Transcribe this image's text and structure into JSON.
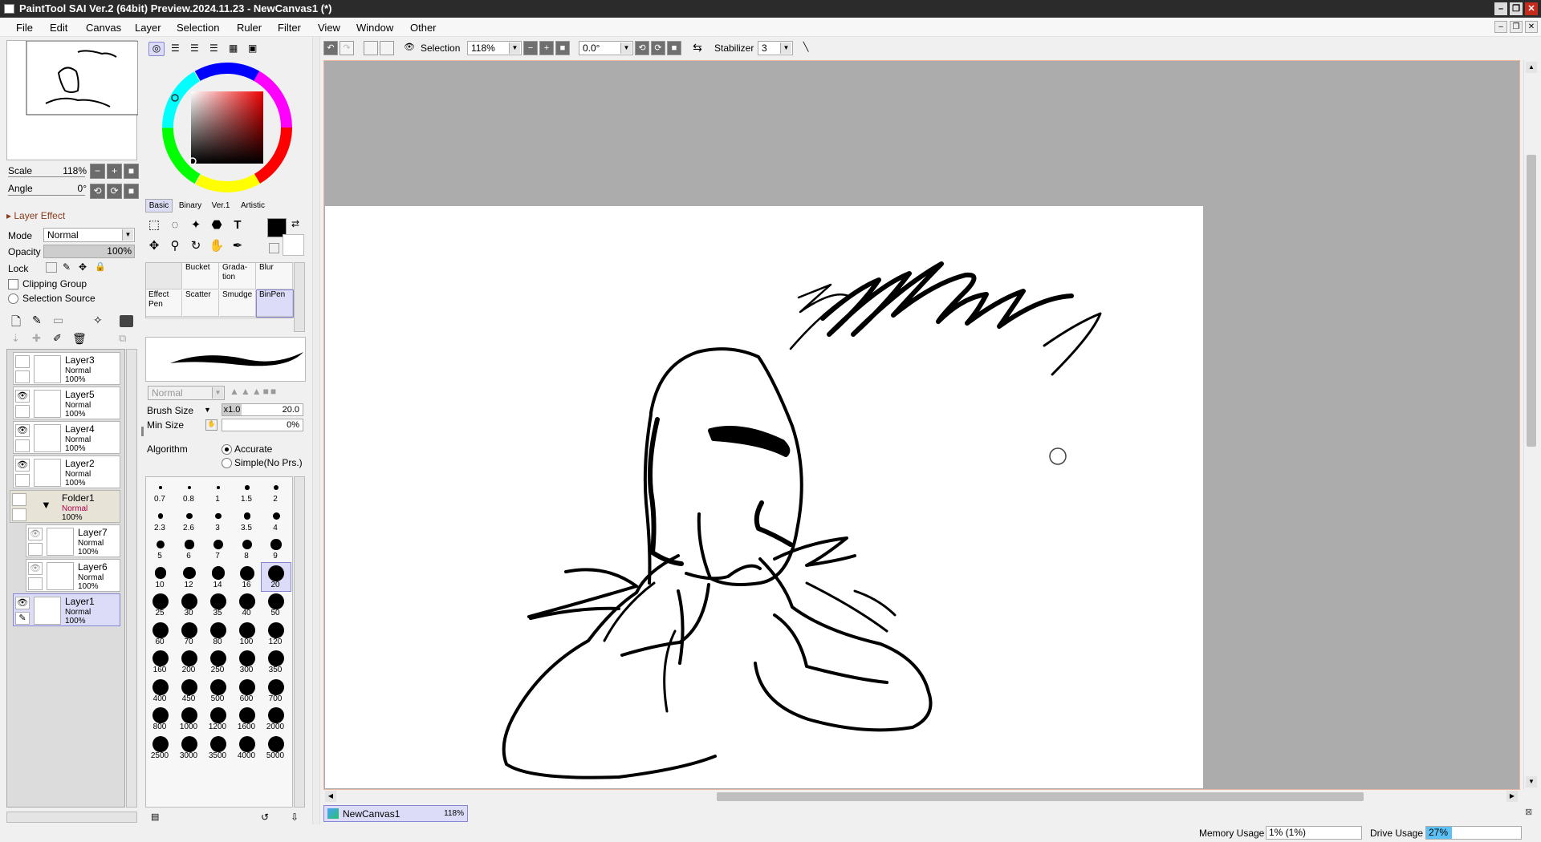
{
  "window": {
    "title": "PaintTool SAI Ver.2 (64bit) Preview.2024.11.23 - NewCanvas1 (*)",
    "controls": [
      "–",
      "❐",
      "✕"
    ]
  },
  "menu": [
    "File",
    "Edit",
    "Canvas",
    "Layer",
    "Selection",
    "Ruler",
    "Filter",
    "View",
    "Window",
    "Other"
  ],
  "navigator": {
    "scale_label": "Scale",
    "scale_value": "118%",
    "angle_label": "Angle",
    "angle_value": "0°"
  },
  "layer_panel": {
    "effect_label": "Layer Effect",
    "mode_label": "Mode",
    "mode_value": "Normal",
    "opacity_label": "Opacity",
    "opacity_value": "100%",
    "lock_label": "Lock",
    "clipping_label": "Clipping Group",
    "selection_source_label": "Selection Source",
    "layers": [
      {
        "name": "Layer3",
        "mode": "Normal",
        "opacity": "100%",
        "visible": false
      },
      {
        "name": "Layer5",
        "mode": "Normal",
        "opacity": "100%",
        "visible": true
      },
      {
        "name": "Layer4",
        "mode": "Normal",
        "opacity": "100%",
        "visible": true
      },
      {
        "name": "Layer2",
        "mode": "Normal",
        "opacity": "100%",
        "visible": true
      },
      {
        "name": "Folder1",
        "mode": "Normal",
        "opacity": "100%",
        "visible": false
      },
      {
        "name": "Layer7",
        "mode": "Normal",
        "opacity": "100%",
        "visible": true
      },
      {
        "name": "Layer6",
        "mode": "Normal",
        "opacity": "100%",
        "visible": true
      },
      {
        "name": "Layer1",
        "mode": "Normal",
        "opacity": "100%",
        "visible": true
      }
    ]
  },
  "color_tabs": [
    "Basic",
    "Binary",
    "Ver.1",
    "Artistic"
  ],
  "brushes": [
    {
      "label": "Bucket",
      "l2": ""
    },
    {
      "label": "Grada-",
      "l2": "tion"
    },
    {
      "label": "Blur",
      "l2": ""
    },
    {
      "label": "Effect",
      "l2": "Pen"
    },
    {
      "label": "Scatter",
      "l2": ""
    },
    {
      "label": "Smudge",
      "l2": ""
    },
    {
      "label": "BinPen",
      "l2": ""
    }
  ],
  "brush_settings": {
    "blend": "Normal",
    "size_label": "Brush Size",
    "size_mult": "x1.0",
    "size_value": "20.0",
    "min_label": "Min Size",
    "min_value": "0%",
    "algo_label": "Algorithm",
    "algo_accurate": "Accurate",
    "algo_simple": "Simple(No Prs.)"
  },
  "brush_sizes": [
    "0.7",
    "0.8",
    "1",
    "1.5",
    "2",
    "2.3",
    "2.6",
    "3",
    "3.5",
    "4",
    "5",
    "6",
    "7",
    "8",
    "9",
    "10",
    "12",
    "14",
    "16",
    "20",
    "25",
    "30",
    "35",
    "40",
    "50",
    "60",
    "70",
    "80",
    "100",
    "120",
    "160",
    "200",
    "250",
    "300",
    "350",
    "400",
    "450",
    "500",
    "600",
    "700",
    "800",
    "1000",
    "1200",
    "1600",
    "2000",
    "2500",
    "3000",
    "3500",
    "4000",
    "5000"
  ],
  "selected_brush_size": "20",
  "toolbar": {
    "selection_label": "Selection",
    "zoom": "118%",
    "angle": "0.0°",
    "stabilizer_label": "Stabilizer",
    "stabilizer_value": "3"
  },
  "canvas_tab": {
    "name": "NewCanvas1",
    "zoom": "118%"
  },
  "status": {
    "memory_label": "Memory Usage",
    "memory_value": "1% (1%)",
    "drive_label": "Drive Usage",
    "drive_value": "27%"
  }
}
